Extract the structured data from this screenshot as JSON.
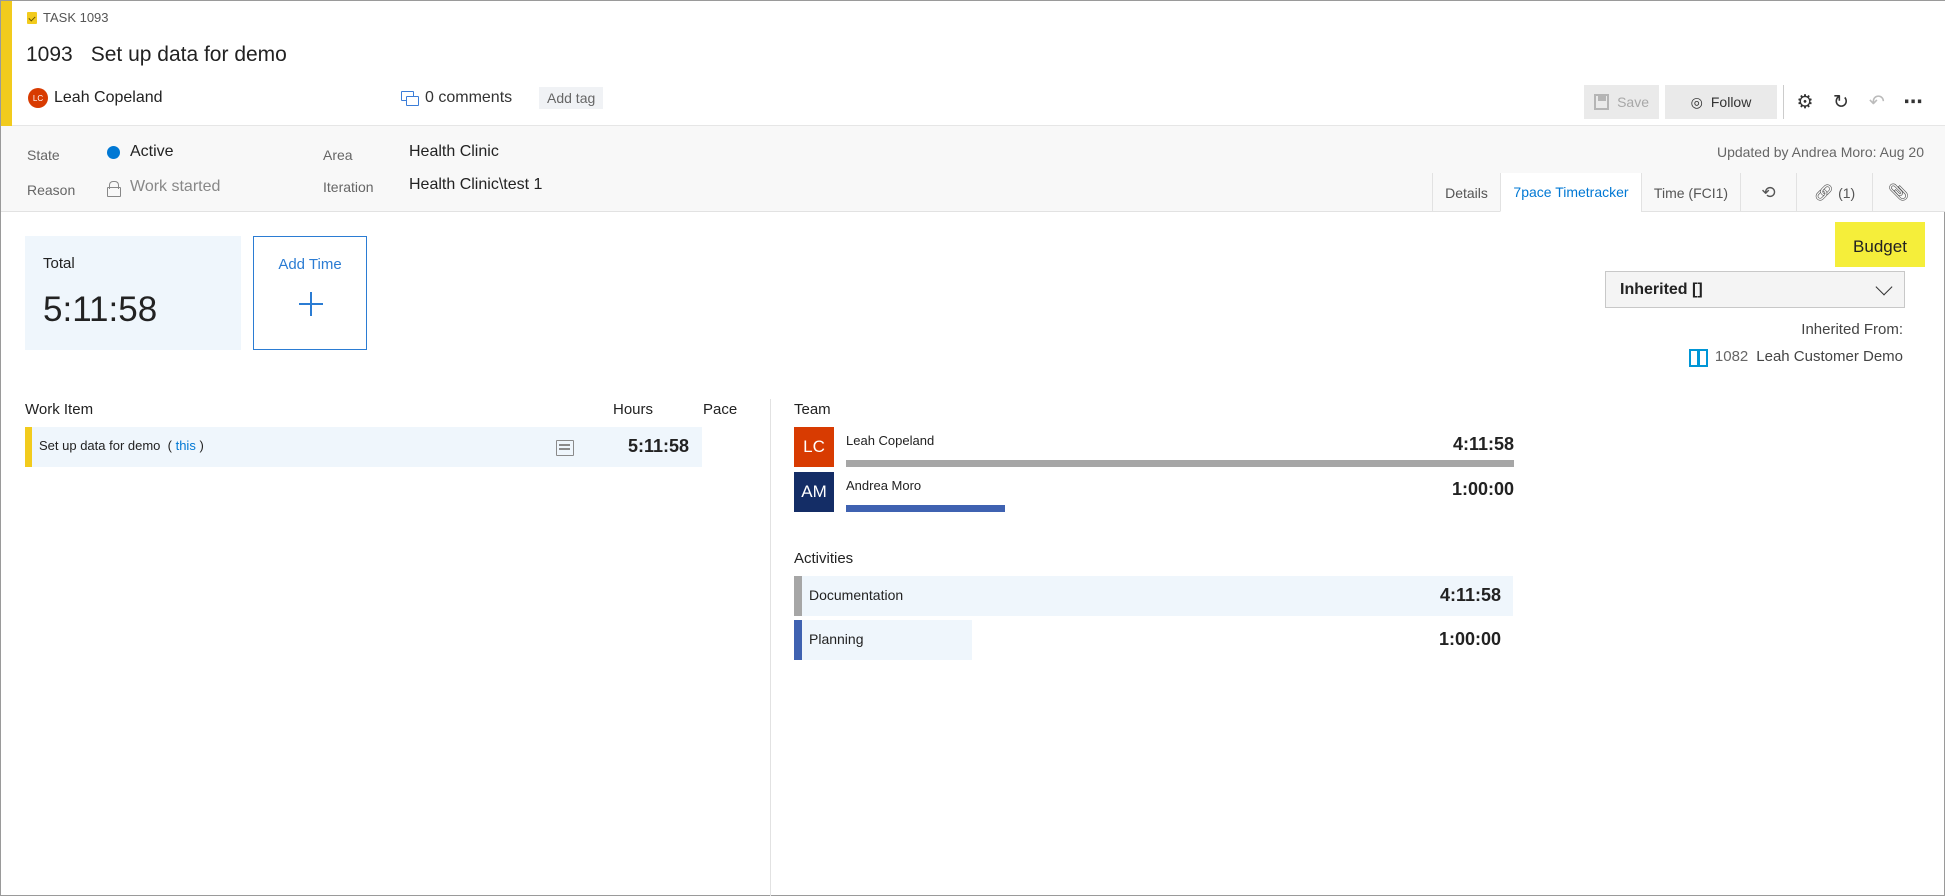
{
  "header": {
    "task_type": "TASK 1093",
    "id": "1093",
    "title": "Set up data for demo",
    "owner": {
      "name": "Leah Copeland",
      "initials": "LC"
    },
    "comments": "0 comments",
    "add_tag": "Add tag"
  },
  "toolbar": {
    "save_label": "Save",
    "follow_label": "Follow",
    "icons": [
      "settings-icon",
      "refresh-icon",
      "undo-icon",
      "more-icon"
    ]
  },
  "fields": {
    "state_label": "State",
    "state_value": "Active",
    "reason_label": "Reason",
    "reason_value": "Work started",
    "area_label": "Area",
    "area_value": "Health Clinic",
    "iteration_label": "Iteration",
    "iteration_value": "Health Clinic\\test 1",
    "updated": "Updated by Andrea Moro: Aug 20"
  },
  "tabs": [
    {
      "label": "Details"
    },
    {
      "label": "7pace Timetracker",
      "active": true
    },
    {
      "label": "Time (FCI1)"
    },
    {
      "label": "",
      "icon": "history-icon"
    },
    {
      "label": "(1)",
      "icon": "link-icon"
    },
    {
      "label": "",
      "icon": "attachment-icon"
    }
  ],
  "timetracker": {
    "total_label": "Total",
    "total_value": "5:11:58",
    "add_time_label": "Add Time"
  },
  "budget": {
    "label": "Budget",
    "selected": "Inherited []",
    "inherited_from_label": "Inherited From:",
    "inherited_id": "1082",
    "inherited_name": "Leah Customer Demo"
  },
  "work_items": {
    "columns": [
      "Work Item",
      "Hours",
      "Pace"
    ],
    "rows": [
      {
        "title": "Set up data for demo",
        "this_label": "this",
        "hours": "5:11:58"
      }
    ]
  },
  "team": {
    "label": "Team",
    "members": [
      {
        "initials": "LC",
        "name": "Leah Copeland",
        "time": "4:11:58",
        "fraction": 1.0,
        "color": "#d83b01",
        "bar_color": "#a6a6a6"
      },
      {
        "initials": "AM",
        "name": "Andrea Moro",
        "time": "1:00:00",
        "fraction": 0.238,
        "color": "#142d66",
        "bar_color": "#3f62b1"
      }
    ]
  },
  "activities": {
    "label": "Activities",
    "items": [
      {
        "name": "Documentation",
        "time": "4:11:58",
        "fraction": 1.0,
        "accent": "#a6a6a6"
      },
      {
        "name": "Planning",
        "time": "1:00:00",
        "fraction": 0.238,
        "accent": "#3f62b1"
      }
    ]
  },
  "colors": {
    "accent_yellow": "#f2cb1d",
    "link_blue": "#0078d4",
    "budget_highlight": "#f5ee3a"
  }
}
